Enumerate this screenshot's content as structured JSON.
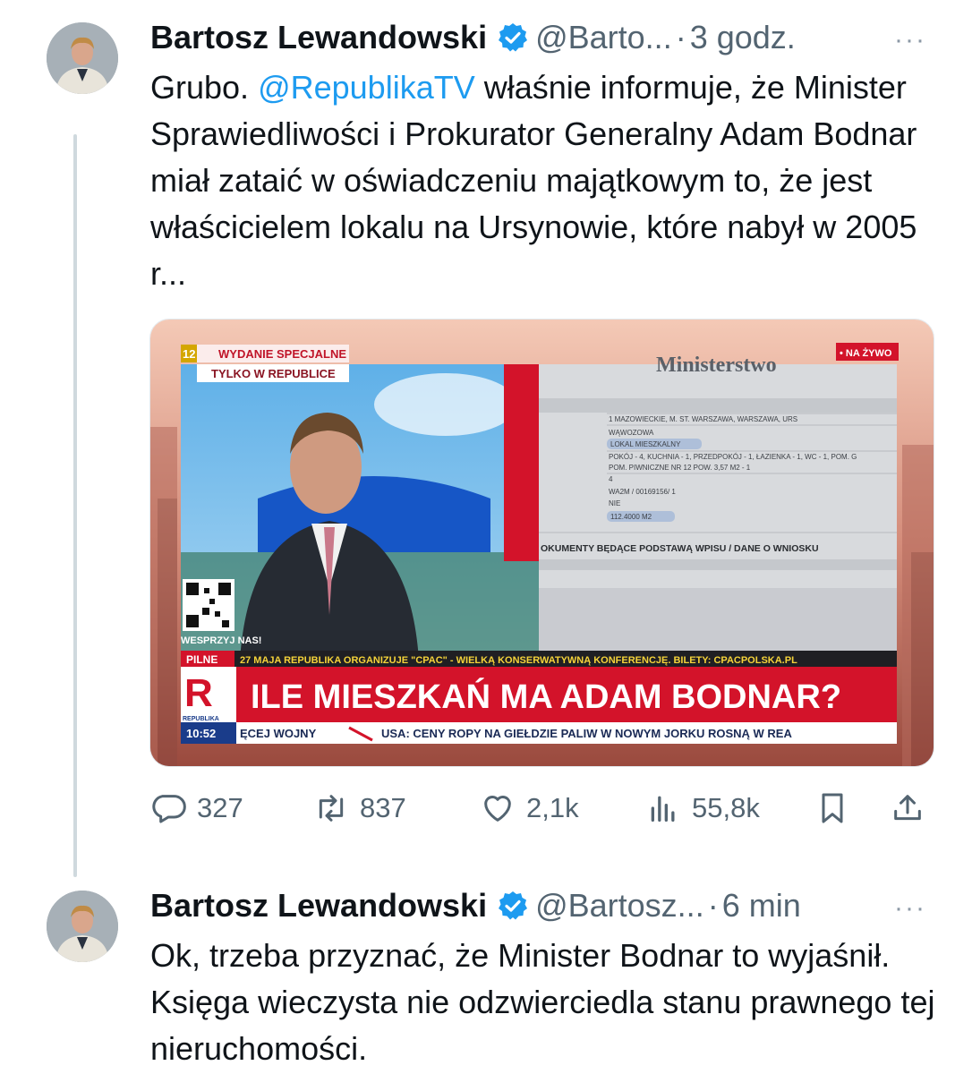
{
  "tweets": [
    {
      "author": "Bartosz Lewandowski",
      "handle": "@Barto...",
      "separator": "·",
      "time": "3 godz.",
      "more": "···",
      "text_before": "Grubo. ",
      "mention": "@RepublikaTV",
      "text_after": " właśnie informuje, że Minister Sprawiedliwości i Prokurator Generalny Adam Bodnar miał zataić w oświadczeniu majątkowym to, że jest właścicielem lokalu na Ursynowie, które nabył w 2005 r...",
      "actions": {
        "replies": "327",
        "reposts": "837",
        "likes": "2,1k",
        "views": "55,8k"
      }
    },
    {
      "author": "Bartosz Lewandowski",
      "handle": "@Bartosz...",
      "separator": "·",
      "time": "6 min",
      "more": "···",
      "text": "Ok, trzeba przyznać, że Minister Bodnar to wyjaśnił. Księga wieczysta nie odzwierciedla stanu prawnego tej nieruchomości."
    }
  ],
  "media": {
    "channel_number": "12",
    "special_edition": "WYDANIE SPECJALNE",
    "only_in": "TYLKO W REPUBLICE",
    "live": "• NA ŻYWO",
    "doc_header": "Ministerstwo",
    "doc_rows": [
      "1                MAZOWIECKIE, M. ST. WARSZAWA, WARSZAWA, URS",
      "WĄWOZOWA",
      "LOKAL MIESZKALNY",
      "POKÓJ - 4, KUCHNIA - 1, PRZEDPOKÓJ - 1, ŁAZIENKA - 1, WC - 1, POM. G",
      "POM. PIWNICZNE NR 12 POW. 3,57 M2 - 1",
      "4",
      "WA2M / 00169156/ 1",
      "NIE",
      "112.4000 M2"
    ],
    "doc_footer": "OKUMENTY BĘDĄCE PODSTAWĄ WPISU / DANE O WNIOSKU",
    "support": "WESPRZYJ NAS!",
    "breaking_label": "PILNE",
    "breaking_text": "27 MAJA REPUBLIKA ORGANIZUJE \"CPAC\" - WIELKĄ KONSERWATYWNĄ KONFERENCJĘ. BILETY: CPACPOLSKA.PL",
    "headline": "ILE MIESZKAŃ MA ADAM BODNAR?",
    "logo_letter": "R",
    "logo_name": "REPUBLIKA",
    "clock": "10:52",
    "ticker_left": "ĘCEJ WOJNY",
    "ticker_right": "USA: CENY ROPY NA GIEŁDZIE PALIW W NOWYM JORKU ROSNĄ W REA"
  },
  "colors": {
    "accent": "#1d9bf0",
    "muted": "#536471",
    "breaking_red": "#d3132a"
  }
}
